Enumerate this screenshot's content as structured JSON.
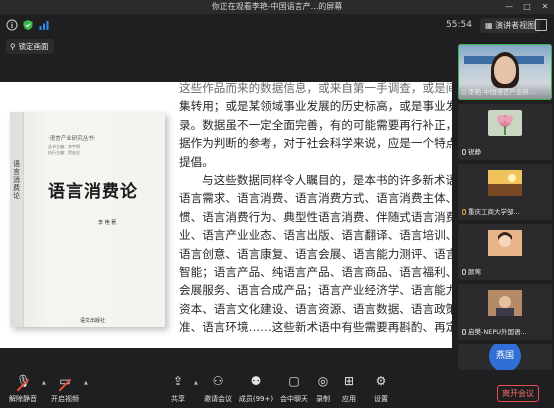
{
  "window": {
    "title": "你正在观看李艳-中国语言产...的屏幕"
  },
  "status": {
    "timer": "55:54",
    "view_mode": "演讲者视图"
  },
  "lock_button": "锁定画面",
  "shared_content": {
    "book": {
      "series_title": "·语言产业研究丛书·",
      "meta_line1": "丛书主编：李宇明",
      "meta_line2": "执行主编：贺宏志",
      "cover_title": "语言消费论",
      "author": "李 艳 著",
      "spine_text": "语言消费论",
      "publisher": "语文出版社"
    },
    "lines": [
      "这些作品而来的数据信息，或来自第一手调查，或是间接收",
      "集转用；或是某领域事业发展的历史标高，或是事业发展的当下记",
      "录。数据虽不一定全面完善，有的可能需要再行补正，但是利用数",
      "据作为判断的参考，对于社会科学来说，应是一个特点，应当引以",
      "提倡。",
      "与这些数据同样令人瞩目的，是本书的许多新术语，例如：",
      "语言需求、语言消费、语言消费方式、语言消费主体、语言消费习",
      "惯、语言消费行为、典型性语言消费、伴随式语言消费；语言产",
      "业、语言产业业态、语言出版、语言翻译、语言培训、语言艺术、",
      "语言创意、语言康复、语言会展、语言能力测评、语言技术、语言",
      "智能；语言产品、纯语言产品、语言商品、语言福利、语言服务、",
      "会展服务、语言合成产品；语言产业经济学、语言能力、语言人力",
      "资本、语言文化建设、语言资源、语言数据、语言政策、语言标",
      "准、语言环境……这些新术语中有些需要再斟酌、再定义，但这是新"
    ]
  },
  "participants": [
    {
      "name": "李艳-中国语言产业研...",
      "type": "video",
      "speaking": true
    },
    {
      "name": "锐静",
      "type": "image",
      "avatar_color": "#c9d7c2"
    },
    {
      "name": "重庆工商大学邹...",
      "type": "image",
      "avatar_color": "#e0a640"
    },
    {
      "name": "颜莺",
      "type": "image",
      "avatar_color": "#d48a5a"
    },
    {
      "name": "启樊-NEPU外国语...",
      "type": "image",
      "avatar_color": "#9a6a4a"
    },
    {
      "name": "燕国",
      "type": "initials",
      "avatar_color": "#2f6fd6"
    }
  ],
  "toolbar": {
    "unmute": "解除静音",
    "video": "开启视频",
    "share": "共享",
    "invite": "邀请会议",
    "members": "成员(99+)",
    "chat": "会中聊天",
    "record": "录制",
    "apps": "应用",
    "settings": "设置",
    "leave": "离开会议"
  },
  "colors": {
    "accent_red": "#e45050",
    "speaking_green": "#39b54a",
    "shield_green": "#39b54a"
  }
}
